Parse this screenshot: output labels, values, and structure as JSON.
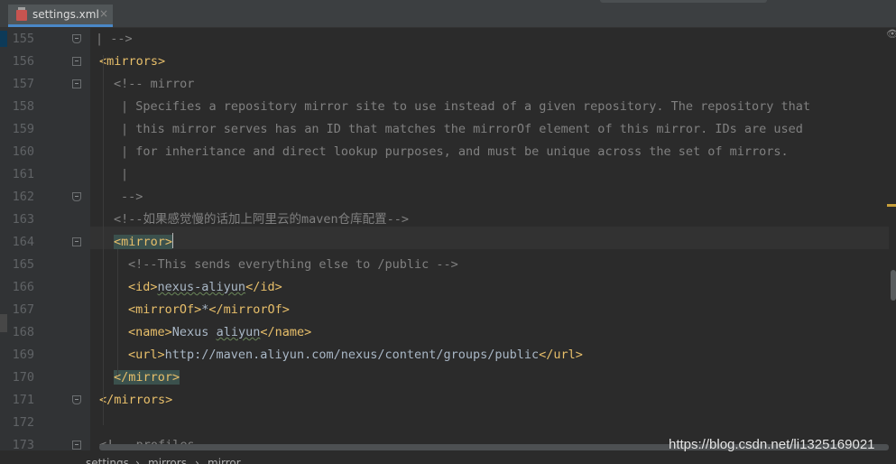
{
  "tab": {
    "filename": "settings.xml",
    "close_glyph": "×",
    "icon": "xml-file-icon"
  },
  "lines": [
    {
      "num": "155",
      "parts": [
        {
          "t": "-->",
          "c": "cm"
        }
      ],
      "indent": 22,
      "bar": true
    },
    {
      "num": "156",
      "parts": [
        {
          "t": "<mirrors>",
          "c": "tag"
        }
      ],
      "indent": 10
    },
    {
      "num": "157",
      "parts": [
        {
          "t": "<!-- mirror",
          "c": "cm"
        }
      ],
      "indent": 26
    },
    {
      "num": "158",
      "parts": [
        {
          "t": "Specifies a repository mirror site to use instead of a given repository. The repository that",
          "c": "cm"
        }
      ],
      "indent": 50,
      "bar": true
    },
    {
      "num": "159",
      "parts": [
        {
          "t": "this mirror serves has an ID that matches the mirrorOf element of this mirror. IDs are used",
          "c": "cm"
        }
      ],
      "indent": 50,
      "bar": true
    },
    {
      "num": "160",
      "parts": [
        {
          "t": "for inheritance and direct lookup purposes, and must be unique across the set of mirrors.",
          "c": "cm"
        }
      ],
      "indent": 50,
      "bar": true
    },
    {
      "num": "161",
      "parts": [],
      "indent": 50,
      "bar": true
    },
    {
      "num": "162",
      "parts": [
        {
          "t": "-->",
          "c": "cm"
        }
      ],
      "indent": 34
    },
    {
      "num": "163",
      "parts": [
        {
          "t": "<!--如果感觉慢的话加上阿里云的maven仓库配置-->",
          "c": "cm"
        }
      ],
      "indent": 26
    },
    {
      "num": "164",
      "parts": [
        {
          "t": "<mirror>",
          "c": "tag hl"
        }
      ],
      "indent": 26,
      "caret": true
    },
    {
      "num": "165",
      "parts": [
        {
          "t": "<!--This sends everything else to /public -->",
          "c": "cm"
        }
      ],
      "indent": 42
    },
    {
      "num": "166",
      "parts": [
        {
          "t": "<id>",
          "c": "tag"
        },
        {
          "t": "nexus-aliyun",
          "c": "txt squig"
        },
        {
          "t": "</id>",
          "c": "tag"
        }
      ],
      "indent": 42
    },
    {
      "num": "167",
      "parts": [
        {
          "t": "<mirrorOf>",
          "c": "tag"
        },
        {
          "t": "*",
          "c": "txt"
        },
        {
          "t": "</mirrorOf>",
          "c": "tag"
        }
      ],
      "indent": 42
    },
    {
      "num": "168",
      "parts": [
        {
          "t": "<name>",
          "c": "tag"
        },
        {
          "t": "Nexus ",
          "c": "txt"
        },
        {
          "t": "aliyun",
          "c": "txt squig"
        },
        {
          "t": "</name>",
          "c": "tag"
        }
      ],
      "indent": 42
    },
    {
      "num": "169",
      "parts": [
        {
          "t": "<url>",
          "c": "tag"
        },
        {
          "t": "http://maven.aliyun.com/nexus/content/groups/public",
          "c": "txt"
        },
        {
          "t": "</url>",
          "c": "tag"
        }
      ],
      "indent": 42
    },
    {
      "num": "170",
      "parts": [
        {
          "t": "</mirror>",
          "c": "tag hl"
        }
      ],
      "indent": 26
    },
    {
      "num": "171",
      "parts": [
        {
          "t": "</mirrors>",
          "c": "tag"
        }
      ],
      "indent": 10
    },
    {
      "num": "172",
      "parts": [],
      "indent": 10
    },
    {
      "num": "173",
      "parts": [
        {
          "t": "<!-- profiles",
          "c": "cm"
        }
      ],
      "indent": 10
    }
  ],
  "breadcrumb": [
    "settings",
    "mirrors",
    "mirror"
  ],
  "breadcrumb_sep": "›",
  "watermark": "https://blog.csdn.net/li1325169021",
  "colors": {
    "tag": "#e8bf6a",
    "comment": "#808080",
    "text": "#a9b7c6",
    "background": "#2b2b2b",
    "gutter": "#313335"
  }
}
